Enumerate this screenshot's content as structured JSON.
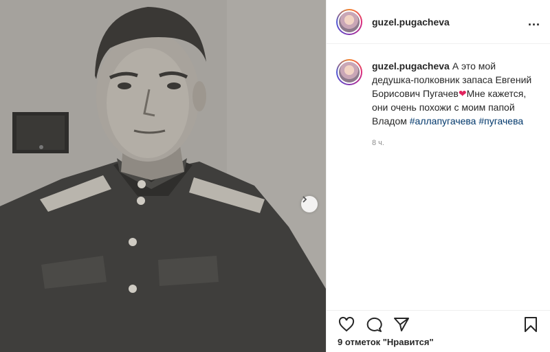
{
  "post": {
    "username": "guzel.pugacheva",
    "caption_text": "А это мой дедушка-полковник запаса Евгений Борисович Пугачев",
    "heart": "❤",
    "caption_text2": "Мне кажется, они очень похожи с моим папой Владом",
    "hashtags": [
      "#аллапугачева",
      "#пугачева"
    ],
    "time": "8 ч.",
    "likes": "9 отметок \"Нравится\"",
    "more": "..."
  },
  "icons": {
    "like": "heart-outline-icon",
    "comment": "comment-bubble-icon",
    "share": "paper-plane-icon",
    "save": "bookmark-icon",
    "next": "chevron-right-icon"
  },
  "colors": {
    "hashtag": "#00376b",
    "heart": "#e0245e",
    "time": "#8e8e8e"
  }
}
